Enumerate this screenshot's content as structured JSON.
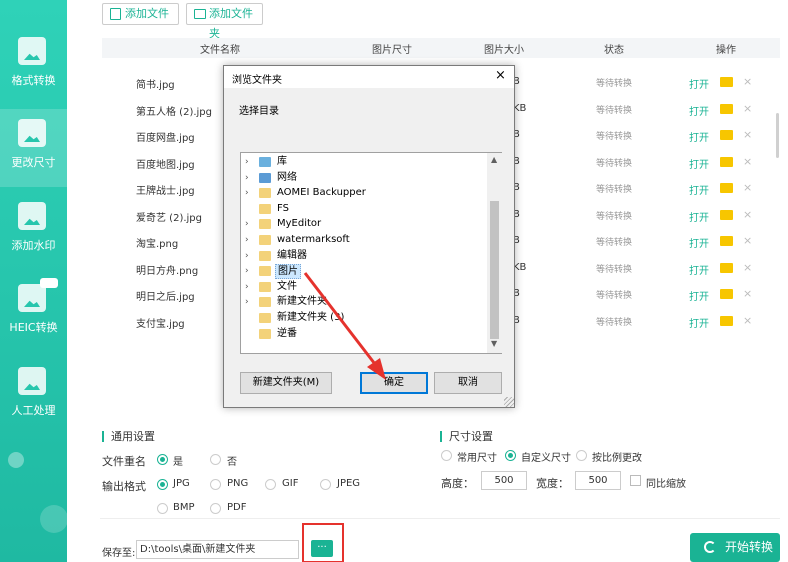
{
  "sidebar": {
    "items": [
      {
        "label": "格式转换"
      },
      {
        "label": "更改尺寸"
      },
      {
        "label": "添加水印"
      },
      {
        "label": "HEIC转换"
      },
      {
        "label": "人工处理"
      }
    ]
  },
  "toolbar": {
    "add_file": "添加文件",
    "add_folder": "添加文件夹"
  },
  "table": {
    "headers": [
      "文件名称",
      "图片尺寸",
      "图片大小",
      "状态",
      "操作"
    ],
    "rows": [
      {
        "name": "简书.jpg",
        "size": "B",
        "status": "等待转换",
        "open": "打开"
      },
      {
        "name": "第五人格 (2).jpg",
        "size": "KB",
        "status": "等待转换",
        "open": "打开"
      },
      {
        "name": "百度网盘.jpg",
        "size": "B",
        "status": "等待转换",
        "open": "打开"
      },
      {
        "name": "百度地图.jpg",
        "size": "B",
        "status": "等待转换",
        "open": "打开"
      },
      {
        "name": "王牌战士.jpg",
        "size": "B",
        "status": "等待转换",
        "open": "打开"
      },
      {
        "name": "爱奇艺 (2).jpg",
        "size": "B",
        "status": "等待转换",
        "open": "打开"
      },
      {
        "name": "淘宝.png",
        "size": "B",
        "status": "等待转换",
        "open": "打开"
      },
      {
        "name": "明日方舟.png",
        "size": "KB",
        "status": "等待转换",
        "open": "打开"
      },
      {
        "name": "明日之后.jpg",
        "size": "B",
        "status": "等待转换",
        "open": "打开"
      },
      {
        "name": "支付宝.jpg",
        "size": "B",
        "status": "等待转换",
        "open": "打开"
      }
    ],
    "delete_glyph": "×"
  },
  "general": {
    "title": "通用设置",
    "rename_label": "文件重名",
    "rename_yes": "是",
    "rename_no": "否",
    "format_label": "输出格式",
    "formats": [
      "JPG",
      "PNG",
      "GIF",
      "JPEG",
      "BMP",
      "PDF"
    ],
    "save_label": "保存至:",
    "save_path": "D:\\tools\\桌面\\新建文件夹",
    "browse": "···"
  },
  "size": {
    "title": "尺寸设置",
    "opt_common": "常用尺寸",
    "opt_custom": "自定义尺寸",
    "opt_ratio": "按比例更改",
    "height_label": "高度：",
    "height_value": "500",
    "width_label": "宽度：",
    "width_value": "500",
    "proportional": "同比缩放"
  },
  "start_button": "开始转换",
  "dialog": {
    "title": "浏览文件夹",
    "close": "×",
    "subtitle": "选择目录",
    "tree": [
      "库",
      "网络",
      "AOMEI Backupper",
      "FS",
      "MyEditor",
      "watermarksoft",
      "编辑器",
      "图片",
      "文件",
      "新建文件夹",
      "新建文件夹 (3)",
      "逆番"
    ],
    "new_folder": "新建文件夹(M)",
    "ok": "确定",
    "cancel": "取消"
  },
  "colors": {
    "accent": "#1ab394",
    "highlight": "#e5322d"
  }
}
